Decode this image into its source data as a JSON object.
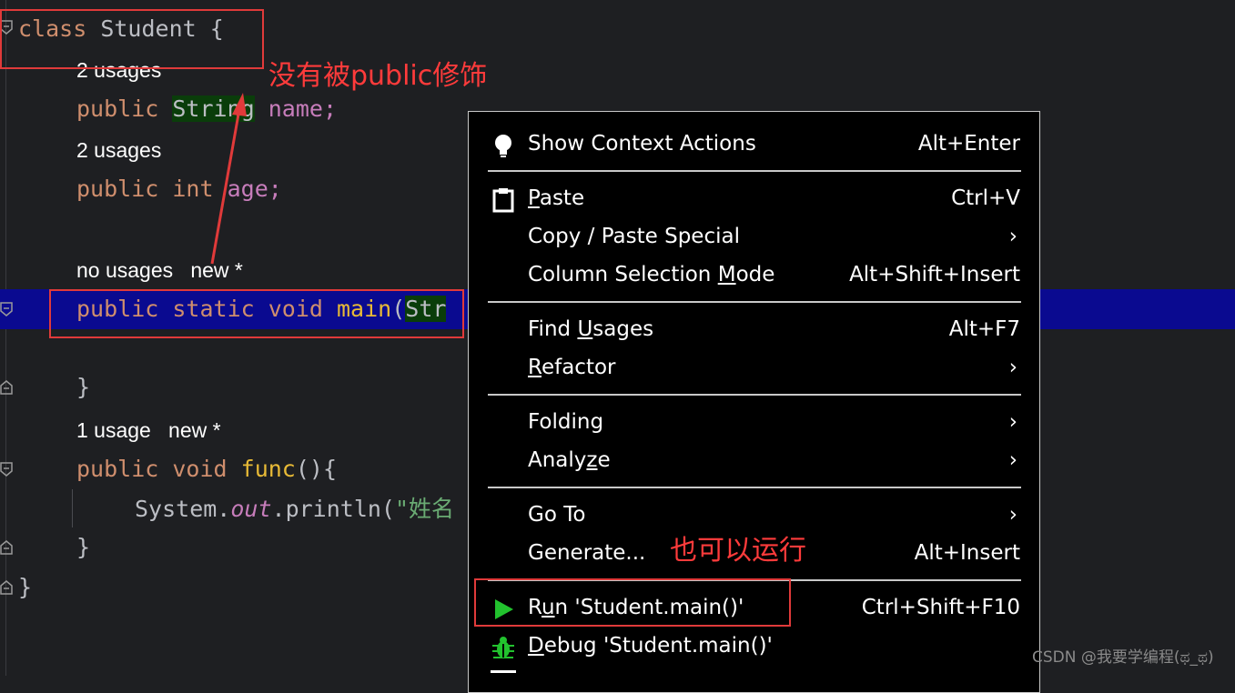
{
  "editor": {
    "code": {
      "class_kw": "class",
      "class_name": " Student {",
      "field1_kw": "public",
      "field1_type": "String",
      "field1_name": "name;",
      "field2_kw": "public",
      "field2_type": "int",
      "field2_name": "age;",
      "main_kw": "public static void",
      "main_name": "main",
      "main_paren": "(",
      "main_arg": "Str",
      "close_main": "}",
      "func_kw": "public void",
      "func_name": "func",
      "func_paren": "(){",
      "print_pre": "System.",
      "print_out": "out",
      "print_mid": ".println(",
      "print_str": "\"姓名",
      "close_func": "}",
      "close_class": "}"
    },
    "hints": {
      "field1_usages": "2 usages",
      "field2_usages": "2 usages",
      "main_usages": "no usages",
      "main_new": "new *",
      "func_usages": "1 usage",
      "func_new": "new *"
    }
  },
  "annotations": {
    "note_public": "没有被public修饰",
    "note_run": "也可以运行"
  },
  "context_menu": {
    "items": [
      {
        "label": "Show Context Actions",
        "shortcut": "Alt+Enter",
        "icon": "lightbulb-icon"
      },
      {
        "label_pre": "",
        "label_u": "P",
        "label_post": "aste",
        "shortcut": "Ctrl+V",
        "icon": "clipboard-icon"
      },
      {
        "label": "Copy / Paste Special",
        "submenu": "›"
      },
      {
        "label_pre": "Column Selection ",
        "label_u": "M",
        "label_post": "ode",
        "shortcut": "Alt+Shift+Insert"
      },
      {
        "label_pre": "Find ",
        "label_u": "U",
        "label_post": "sages",
        "shortcut": "Alt+F7"
      },
      {
        "label_pre": "",
        "label_u": "R",
        "label_post": "efactor",
        "submenu": "›"
      },
      {
        "label": "Folding",
        "submenu": "›"
      },
      {
        "label_pre": "Analy",
        "label_u": "z",
        "label_post": "e",
        "submenu": "›"
      },
      {
        "label": "Go To",
        "submenu": "›"
      },
      {
        "label": "Generate...",
        "shortcut": "Alt+Insert"
      },
      {
        "label_pre": "R",
        "label_u": "u",
        "label_post": "n 'Student.main()'",
        "shortcut": "Ctrl+Shift+F10",
        "icon": "run-icon"
      },
      {
        "label_pre": "",
        "label_u": "D",
        "label_post": "ebug 'Student.main()'",
        "icon": "debug-icon"
      }
    ]
  },
  "colors": {
    "accent_run": "#22c22e",
    "annotation_red": "#e03a3a",
    "current_line": "#0a0a90"
  },
  "watermark": "CSDN @我要学编程(ಥ_ಥ)"
}
